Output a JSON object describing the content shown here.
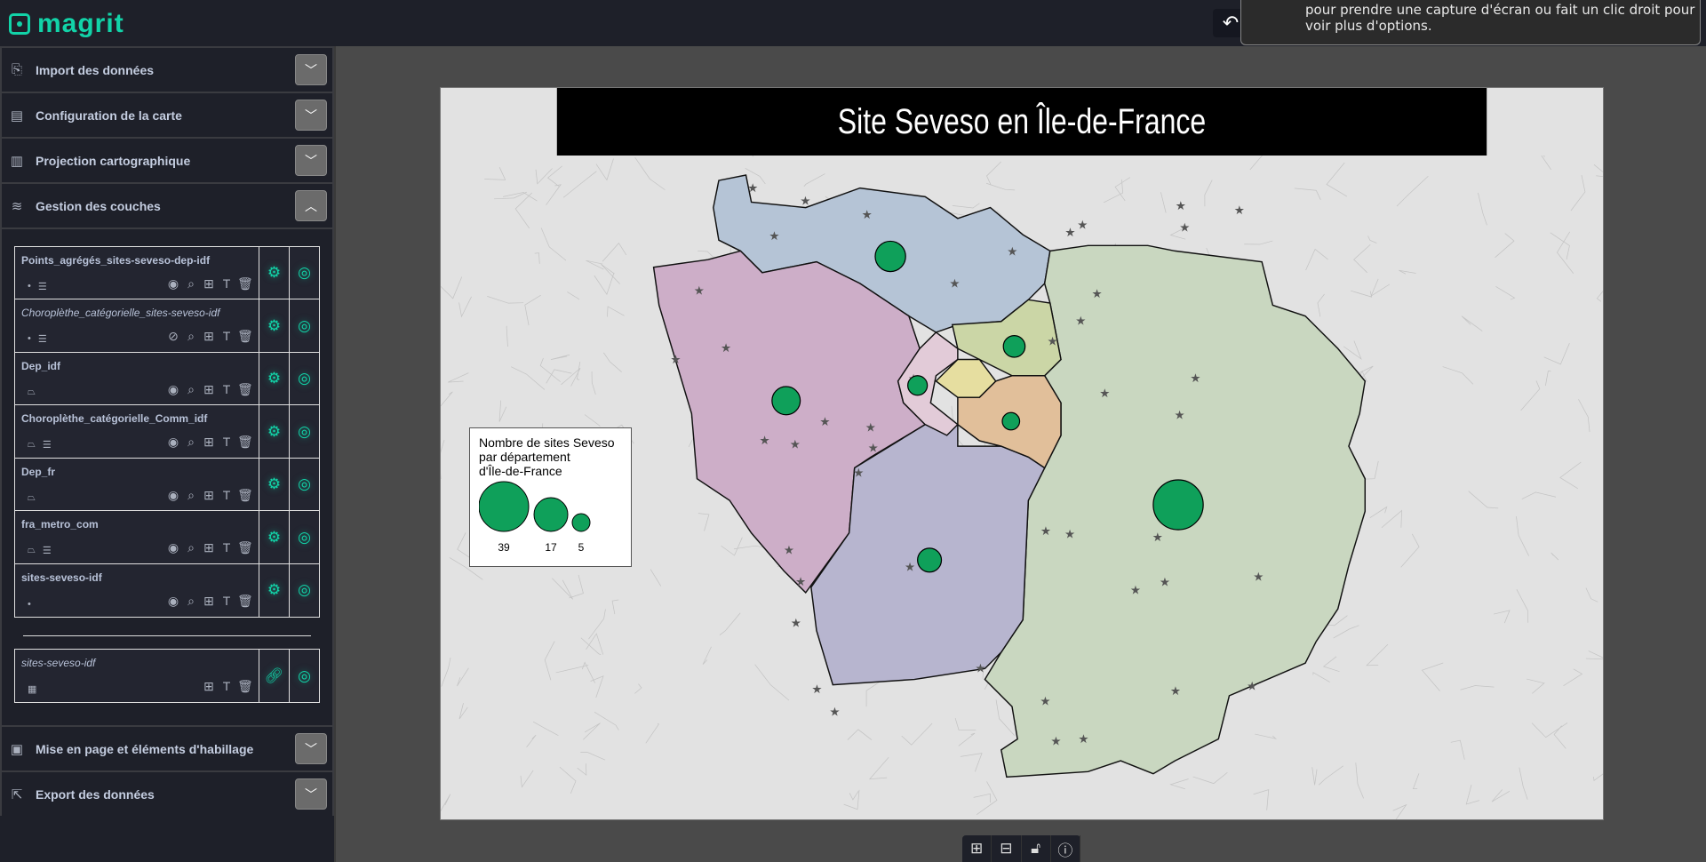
{
  "app": {
    "name": "magrit"
  },
  "toolbar": {
    "undo_icon": "undo-icon",
    "tooltip_lines": [
      "pour prendre une capture d'écran ou fait un clic droit pour",
      "voir plus d'options."
    ]
  },
  "sidebar": {
    "sections_top": [
      {
        "label": "Import des données",
        "icon": "file-import-icon",
        "state": "collapsed"
      },
      {
        "label": "Configuration de la carte",
        "icon": "layout-icon",
        "state": "collapsed"
      },
      {
        "label": "Projection cartographique",
        "icon": "map-icon",
        "state": "collapsed"
      },
      {
        "label": "Gestion des couches",
        "icon": "layers-icon",
        "state": "expanded"
      }
    ],
    "layers": [
      {
        "name": "Points_agrégés_sites-seveso-dep-idf",
        "visible": true,
        "italic": false
      },
      {
        "name": "Choroplèthe_catégorielle_sites-seveso-idf",
        "visible": false,
        "italic": true
      },
      {
        "name": "Dep_idf",
        "visible": true,
        "italic": false
      },
      {
        "name": "Choroplèthe_catégorielle_Comm_idf",
        "visible": true,
        "italic": false
      },
      {
        "name": "Dep_fr",
        "visible": true,
        "italic": false
      },
      {
        "name": "fra_metro_com",
        "visible": true,
        "italic": false
      },
      {
        "name": "sites-seveso-idf",
        "visible": true,
        "italic": false
      }
    ],
    "tables": [
      {
        "name": "sites-seveso-idf"
      }
    ],
    "sections_bottom": [
      {
        "label": "Mise en page et éléments d'habillage",
        "icon": "layout-elements-icon"
      },
      {
        "label": "Export des données",
        "icon": "export-icon"
      }
    ]
  },
  "map": {
    "title": "Site Seveso en Île-de-France",
    "legend": {
      "title_lines": [
        "Nombre de sites Seveso",
        "par département",
        "d'Île-de-France"
      ],
      "values": [
        "39",
        "17",
        "5"
      ]
    },
    "colors": {
      "symbol": "#0fa05a",
      "title_bg": "#000000"
    }
  },
  "map_controls": [
    "zoom-in",
    "zoom-out",
    "lock",
    "info"
  ]
}
